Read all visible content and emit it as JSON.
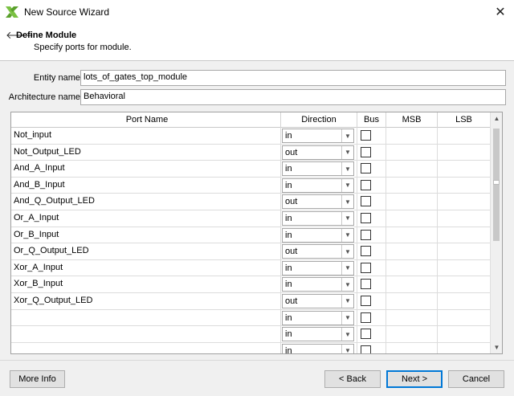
{
  "window": {
    "title": "New Source Wizard"
  },
  "header": {
    "title": "Define Module",
    "subtitle": "Specify ports for module."
  },
  "fields": {
    "entity_label": "Entity name",
    "entity_value": "lots_of_gates_top_module",
    "arch_label": "Architecture name",
    "arch_value": "Behavioral"
  },
  "table": {
    "columns": [
      "Port Name",
      "Direction",
      "Bus",
      "MSB",
      "LSB"
    ],
    "rows": [
      {
        "name": "Not_input",
        "direction": "in",
        "bus": false
      },
      {
        "name": "Not_Output_LED",
        "direction": "out",
        "bus": false
      },
      {
        "name": "And_A_Input",
        "direction": "in",
        "bus": false
      },
      {
        "name": "And_B_Input",
        "direction": "in",
        "bus": false
      },
      {
        "name": "And_Q_Output_LED",
        "direction": "out",
        "bus": false
      },
      {
        "name": "Or_A_Input",
        "direction": "in",
        "bus": false
      },
      {
        "name": "Or_B_Input",
        "direction": "in",
        "bus": false
      },
      {
        "name": "Or_Q_Output_LED",
        "direction": "out",
        "bus": false
      },
      {
        "name": "Xor_A_Input",
        "direction": "in",
        "bus": false
      },
      {
        "name": "Xor_B_Input",
        "direction": "in",
        "bus": false
      },
      {
        "name": "Xor_Q_Output_LED",
        "direction": "out",
        "bus": false
      },
      {
        "name": "",
        "direction": "in",
        "bus": false
      },
      {
        "name": "",
        "direction": "in",
        "bus": false
      },
      {
        "name": "",
        "direction": "in",
        "bus": false
      }
    ]
  },
  "buttons": {
    "more_info": "More Info",
    "back": "< Back",
    "next": "Next >",
    "cancel": "Cancel"
  },
  "colors": {
    "accent": "#0078d7",
    "logo": "#7ac142"
  }
}
